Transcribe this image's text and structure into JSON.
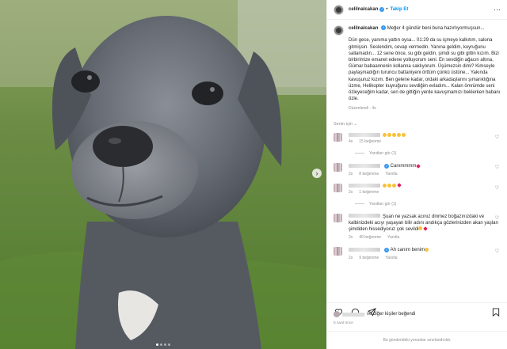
{
  "post": {
    "username": "celilnalcakan",
    "follow_label": "Takip Et",
    "caption_title": "Meğer 4 gündür beni buna hazırlıyormuşsun...",
    "caption_text": "Dün gece, yanıma yattın oysa... 01:29 da su içmeye kalkıtım, salona gitmişsin. Seslendim, cevap vermedin. Yanına geldim, kuyruğunu sallamadın... 12 sene önce, su gibi geldin, şimdi su gibi gittin kızım. Bizi birbirimize emanet edene yolluyorum seni. En sevdiğin ağacın altına, Gümar babaannenin kollanna saklıyorum. Üşümezsin dimi? Kimseyle paylaşmadığın turuncu battaniyeni örttüm çünkü üstüne... Yakında kavuşuruz kızım. Ben gelene kadar, ordaki arkadaşlarını şımarıklığına üzme, Helikopter kuyruğunu sevdiğim evladım... Kalan ömrümde seni özleyeceğim kadar, sen de gittiğin yerde kavuşmamızı beklerken babanı özle.",
    "caption_meta": "Düzenlendi · 4s",
    "for_you_label": "Senin için",
    "time_ago": "5 saat önce",
    "likes_text": "ve diğer kişiler beğendi",
    "comments_closed": "Bu gönderideki yorumlar sınırlandırıldı."
  },
  "comments": [
    {
      "text": "",
      "emoji_count": 5,
      "age": "4s",
      "likes": "15 beğenme",
      "reply": "",
      "has_replies": true,
      "replies_label": "Yanıtları gör (1)"
    },
    {
      "text": "Canımmmm",
      "emoji_count": 0,
      "heart": true,
      "age": "2s",
      "likes": "8 beğenme",
      "reply": "Yanıtla",
      "has_replies": false
    },
    {
      "text": "",
      "emoji_count": 4,
      "heart": true,
      "age": "2s",
      "likes": "1 beğenme",
      "reply": "",
      "has_replies": true,
      "replies_label": "Yanıtları gör (1)"
    },
    {
      "text": "Şuan ne yazsak acınız dinmez boğazınızdaki ve kalbinizdeki acıyı yaşayan bilir adını andıkça gözlerinizden akan yaşları şimdiden hissediyoruz çok sevildi",
      "emoji_count": 1,
      "heart": true,
      "age": "2s",
      "likes": "40 beğenme",
      "reply": "Yanıtla",
      "has_replies": false
    },
    {
      "text": "Ah canım benim",
      "emoji_count": 1,
      "age": "2s",
      "likes": "9 beğenme",
      "reply": "Yanıtla",
      "has_replies": false
    }
  ],
  "media": {
    "slide_count": 4,
    "active_slide": 1
  },
  "icons": [
    "more-icon",
    "heart-icon",
    "comment-icon",
    "share-icon",
    "save-icon",
    "next-icon",
    "verified-icon"
  ]
}
